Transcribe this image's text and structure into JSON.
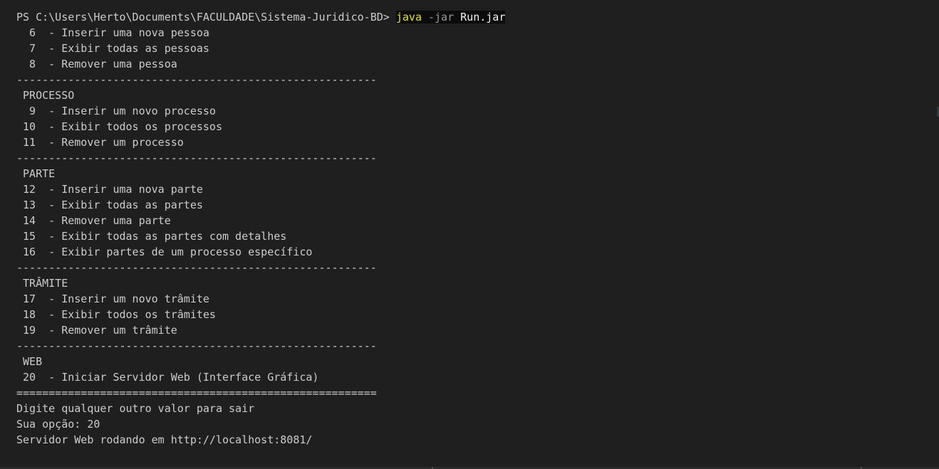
{
  "prompt": {
    "path": "PS C:\\Users\\Herto\\Documents\\FACULDADE\\Sistema-Juridico-BD> ",
    "cmd": "java",
    "flag": "-jar",
    "file": "Run.jar"
  },
  "lines": [
    "  6  - Inserir uma nova pessoa",
    "  7  - Exibir todas as pessoas",
    "  8  - Remover uma pessoa",
    "--------------------------------------------------------",
    " PROCESSO",
    "  9  - Inserir um novo processo",
    " 10  - Exibir todos os processos",
    " 11  - Remover um processo",
    "--------------------------------------------------------",
    " PARTE",
    " 12  - Inserir uma nova parte",
    " 13  - Exibir todas as partes",
    " 14  - Remover uma parte",
    " 15  - Exibir todas as partes com detalhes",
    " 16  - Exibir partes de um processo específico",
    "--------------------------------------------------------",
    " TRÂMITE",
    " 17  - Inserir um novo trâmite",
    " 18  - Exibir todos os trâmites",
    " 19  - Remover um trâmite",
    "--------------------------------------------------------",
    " WEB",
    " 20  - Iniciar Servidor Web (Interface Gráfica)",
    "========================================================",
    "Digite qualquer outro valor para sair",
    "Sua opção: 20",
    "Servidor Web rodando em http://localhost:8081/"
  ]
}
